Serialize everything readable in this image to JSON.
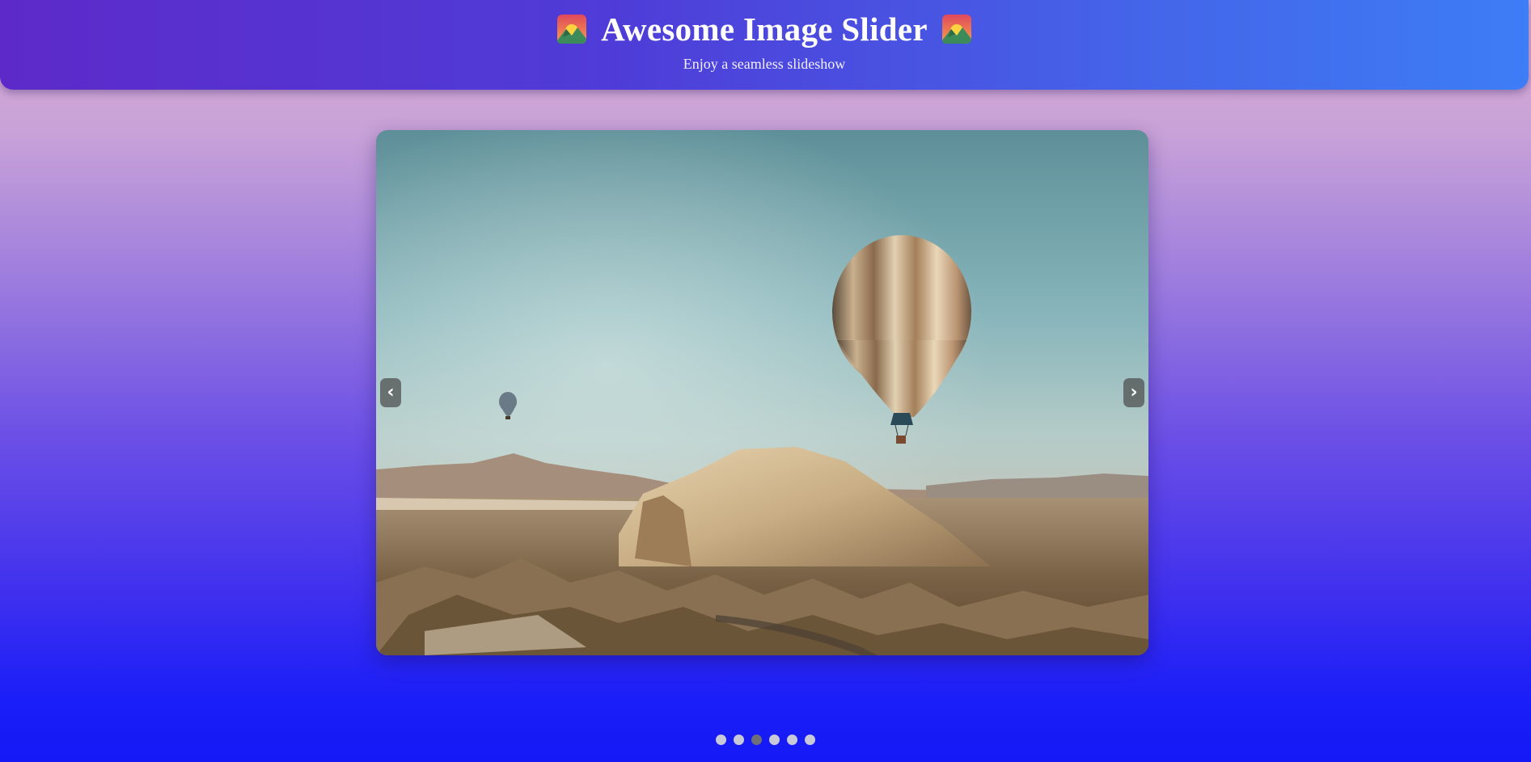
{
  "header": {
    "title": "Awesome Image Slider",
    "subtitle": "Enjoy a seamless slideshow",
    "left_icon": "sunrise-over-mountains-emoji",
    "right_icon": "sunrise-over-mountains-emoji"
  },
  "slider": {
    "prev_label": "‹",
    "next_label": "›",
    "current_slide": 3,
    "total_slides": 6,
    "image_alt": "Hot air balloons over a desert mountain landscape"
  },
  "colors": {
    "header_start": "#5d2ac9",
    "header_end": "#3d7df6",
    "dot_inactive": "#c8c8d8",
    "dot_active": "#6f6f7a"
  }
}
